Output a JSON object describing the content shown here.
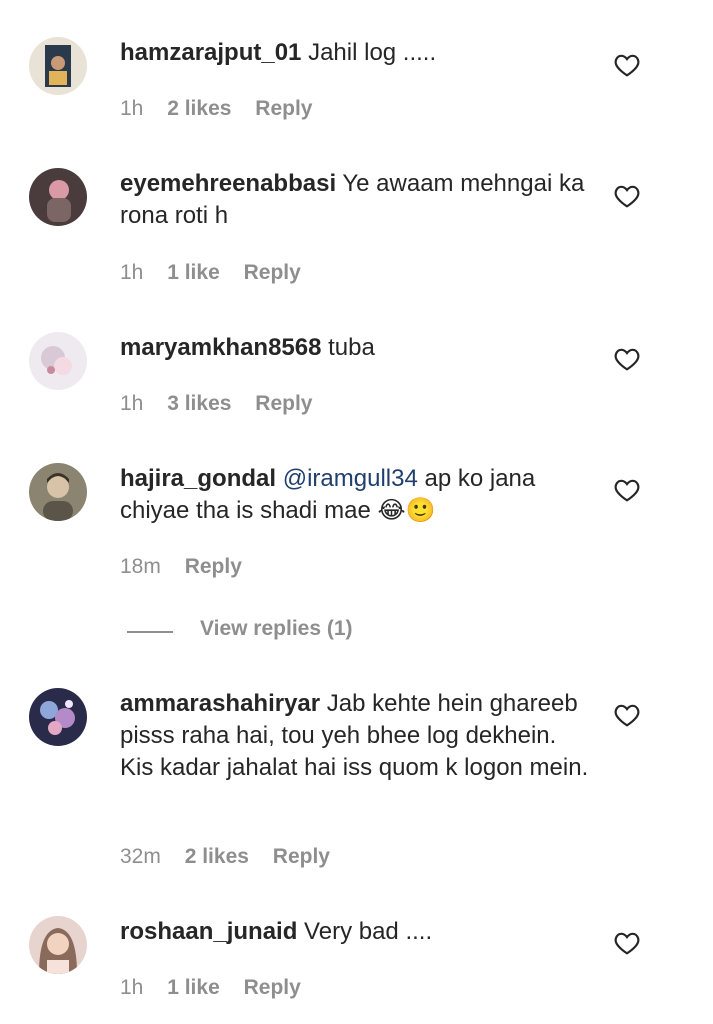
{
  "comments": [
    {
      "username": "hamzarajput_01",
      "text": "Jahil log .....",
      "time": "1h",
      "likes": "2 likes",
      "reply": "Reply"
    },
    {
      "username": "eyemehreenabbasi",
      "text": "Ye awaam mehngai ka rona roti h",
      "time": "1h",
      "likes": "1 like",
      "reply": "Reply"
    },
    {
      "username": "maryamkhan8568",
      "text": "tuba",
      "time": "1h",
      "likes": "3 likes",
      "reply": "Reply"
    },
    {
      "username": "hajira_gondal",
      "mention": "@iramgull34",
      "text": " ap ko jana chiyae tha is shadi mae ",
      "emoji": "😂🙂",
      "time": "18m",
      "reply": "Reply"
    },
    {
      "username": "ammarashahiryar",
      "text": "Jab kehte hein ghareeb pisss raha hai, tou yeh bhee log dekhein. Kis kadar jahalat hai iss quom k logon mein.",
      "time": "32m",
      "likes": "2 likes",
      "reply": "Reply"
    },
    {
      "username": "roshaan_junaid",
      "text": "Very bad ....",
      "time": "1h",
      "likes": "1 like",
      "reply": "Reply"
    }
  ],
  "view_replies": "View replies (1)",
  "icons": {
    "like": "heart-outline-icon"
  }
}
